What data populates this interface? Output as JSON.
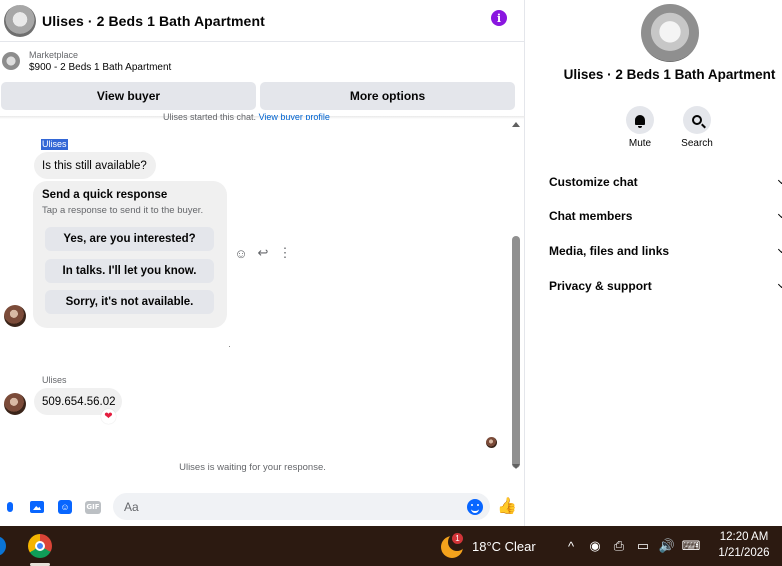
{
  "header": {
    "title": "Ulises · 2 Beds 1 Bath Apartment",
    "info_glyph": "i"
  },
  "marketplace": {
    "kicker": "Marketplace",
    "listing": "$900 - 2 Beds 1 Bath Apartment"
  },
  "actions": {
    "view_buyer": "View buyer",
    "more_options": "More options"
  },
  "thread": {
    "clipped_note_prefix": "Ulises started this chat.",
    "clipped_note_link": "View buyer profile",
    "sender_name_selected": "Ulises",
    "message_1": "Is this still available?",
    "quick_response": {
      "title": "Send a quick response",
      "subtitle": "Tap a response to send it to the buyer.",
      "options": [
        "Yes, are you interested?",
        "In talks. I'll let you know.",
        "Sorry, it's not available."
      ]
    },
    "tools": {
      "react": "☺",
      "reply": "↩",
      "more": "⋮"
    },
    "sender_name": "Ulises",
    "message_2": "509.654.56.02",
    "reaction": "❤",
    "waiting_text": "Ulises is waiting for your response."
  },
  "composer": {
    "placeholder": "Aa",
    "sticker_glyph": "☺",
    "gif_label": "GIF",
    "like_glyph": "👍"
  },
  "info_panel": {
    "title": "Ulises · 2 Beds 1 Bath Apartment",
    "mute_label": "Mute",
    "search_label": "Search",
    "menu": [
      "Customize chat",
      "Chat members",
      "Media, files and links",
      "Privacy & support"
    ]
  },
  "taskbar": {
    "weather_badge": "1",
    "weather": "18°C  Clear",
    "tray_icons": [
      "^",
      "◉",
      "⎙",
      "▭",
      "🔊",
      "⌨"
    ],
    "time": "12:20 AM",
    "date": "1/21/2026"
  },
  "colors": {
    "accent": "#0866ff",
    "info_purple": "#8a16e0",
    "taskbar_bg": "#2c1a11",
    "bubble_bg": "#f0f0f0"
  }
}
